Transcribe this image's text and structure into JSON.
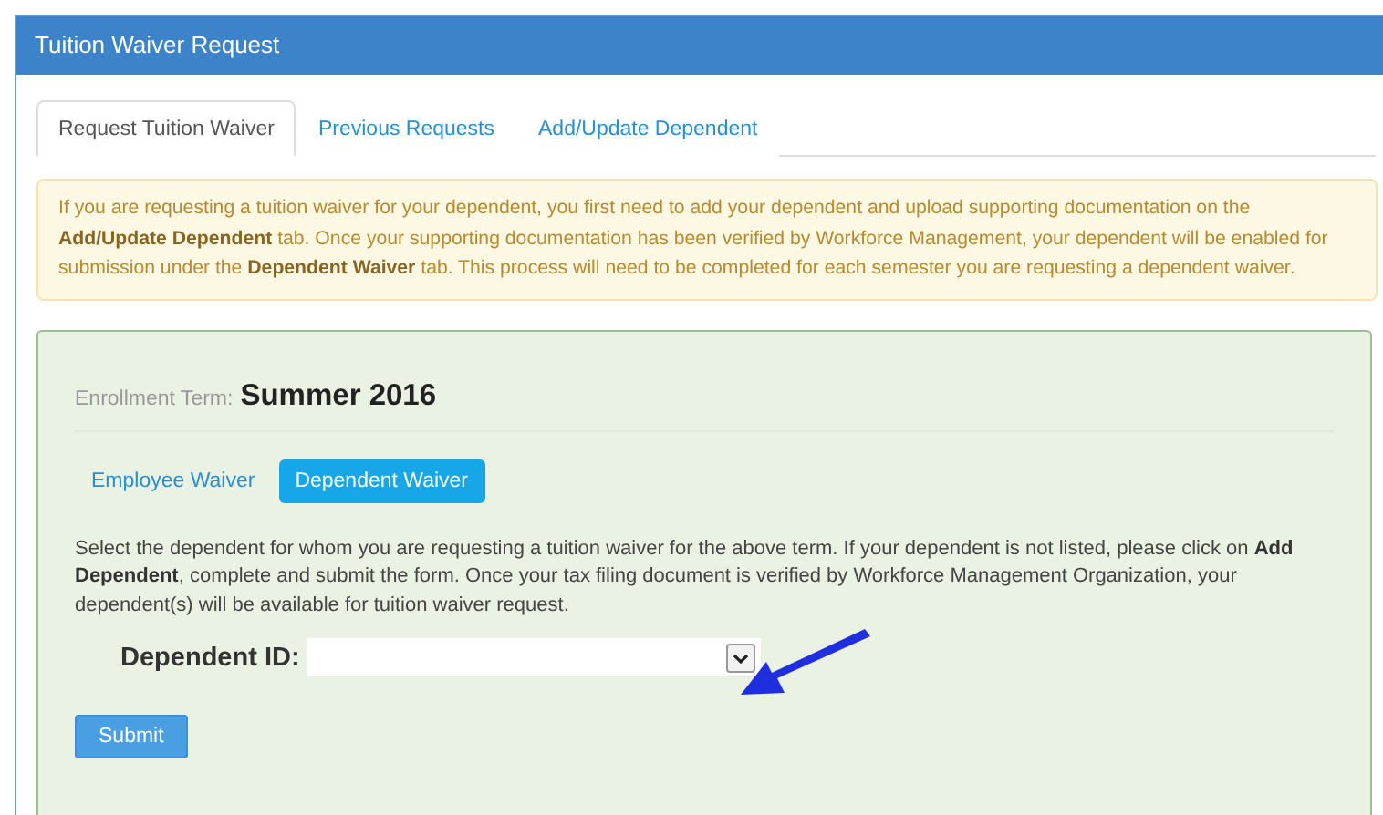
{
  "panel": {
    "title": "Tuition Waiver Request"
  },
  "tabs": [
    {
      "label": "Request Tuition Waiver",
      "selected": true
    },
    {
      "label": "Previous Requests",
      "selected": false
    },
    {
      "label": "Add/Update Dependent",
      "selected": false
    }
  ],
  "alert": "If you are requesting a tuition waiver for your dependent, you first need to add your dependent and upload supporting documentation on the **Add/Update Dependent** tab. Once your supporting documentation has been verified by Workforce Management, your dependent will be enabled for submission under the **Dependent Waiver** tab. This process will need to be completed for each semester you are requesting a dependent waiver.",
  "form": {
    "term_label": "Enrollment Term:",
    "term": "Summer 2016",
    "pills": [
      {
        "label": "Employee Waiver",
        "selected": false
      },
      {
        "label": "Dependent Waiver",
        "selected": true
      }
    ],
    "instructions": "Select the dependent for whom you are requesting a tuition waiver for the above term. If your dependent is not listed, please click on **Add Dependent**, complete and submit the form. Once your tax filing document is verified by Workforce Management Organization, your dependent(s) will be available for tuition waiver request.",
    "field_label": "Dependent ID:",
    "submit": "Submit"
  }
}
